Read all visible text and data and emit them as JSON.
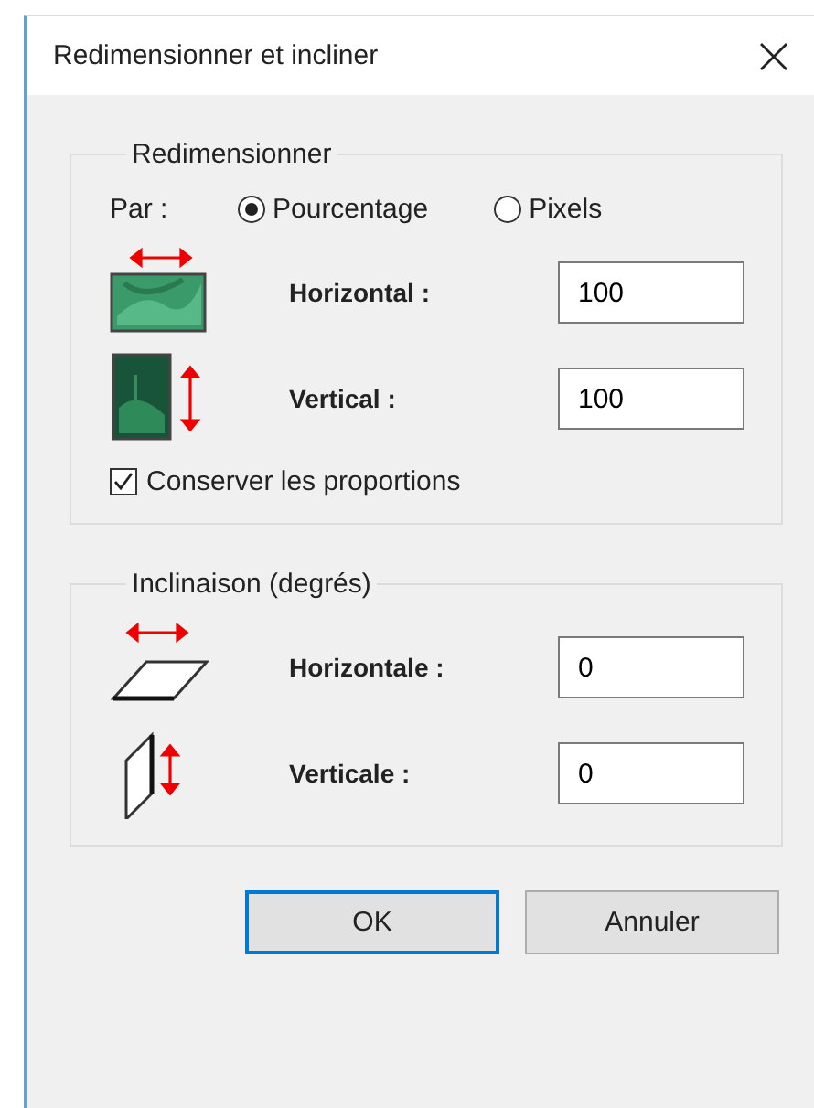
{
  "window": {
    "title": "Redimensionner et incliner"
  },
  "resize": {
    "title": "Redimensionner",
    "by_label": "Par :",
    "units": [
      {
        "label": "Pourcentage",
        "selected": true
      },
      {
        "label": "Pixels",
        "selected": false
      }
    ],
    "fields": [
      {
        "kind": "stretch-horizontal",
        "label": "Horizontal :",
        "value": "100"
      },
      {
        "kind": "stretch-vertical",
        "label": "Vertical :",
        "value": "100"
      }
    ],
    "keep_proportions": {
      "label": "Conserver les proportions",
      "checked": true
    }
  },
  "skew": {
    "title": "Inclinaison (degrés)",
    "fields": [
      {
        "kind": "skew-horizontal",
        "label": "Horizontale :",
        "value": "0"
      },
      {
        "kind": "skew-vertical",
        "label": "Verticale :",
        "value": "0"
      }
    ]
  },
  "buttons": [
    {
      "label": "OK",
      "default": true
    },
    {
      "label": "Annuler",
      "default": false
    }
  ]
}
